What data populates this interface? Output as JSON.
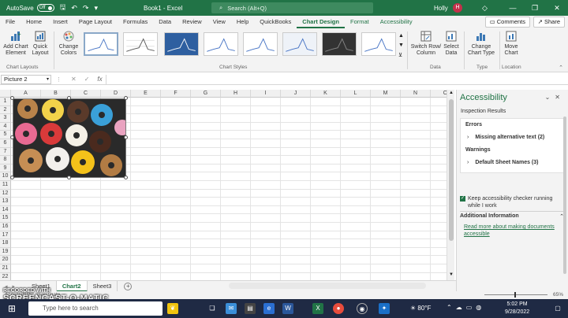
{
  "titlebar": {
    "autosave_label": "AutoSave",
    "autosave_state": "Off",
    "doc_title": "Book1 - Excel",
    "search_placeholder": "Search (Alt+Q)",
    "user_name": "Holly",
    "user_initial": "H"
  },
  "tabs": [
    "File",
    "Home",
    "Insert",
    "Page Layout",
    "Formulas",
    "Data",
    "Review",
    "View",
    "Help",
    "QuickBooks",
    "Chart Design",
    "Format",
    "Accessibility"
  ],
  "active_tab": "Chart Design",
  "actions": {
    "comments": "Comments",
    "share": "Share"
  },
  "ribbon": {
    "add_chart_element": "Add Chart Element",
    "quick_layout": "Quick Layout",
    "change_colors": "Change Colors",
    "chart_layouts_label": "Chart Layouts",
    "chart_styles_label": "Chart Styles",
    "switch_row_column": "Switch Row/ Column",
    "select_data": "Select Data",
    "data_label": "Data",
    "change_chart_type": "Change Chart Type",
    "type_label": "Type",
    "move_chart": "Move Chart",
    "location_label": "Location"
  },
  "formula_bar": {
    "name_box": "Picture 2",
    "fx": "fx",
    "formula": ""
  },
  "columns": [
    "A",
    "B",
    "C",
    "D",
    "E",
    "F",
    "G",
    "H",
    "I",
    "J",
    "K",
    "L",
    "M",
    "N",
    "O"
  ],
  "rows": [
    "1",
    "2",
    "3",
    "4",
    "5",
    "6",
    "7",
    "8",
    "9",
    "10",
    "11",
    "12",
    "13",
    "14",
    "15",
    "16",
    "17",
    "18",
    "19",
    "20",
    "21",
    "22"
  ],
  "sheets": [
    "Sheet1",
    "Chart2",
    "Sheet3"
  ],
  "active_sheet": "Chart2",
  "status": {
    "accessibility": "Accessibility: Investigate",
    "zoom": "65%"
  },
  "watermark": {
    "line1": "RECORDED WITH",
    "line2": "SCREENCAST-O-MATIC"
  },
  "pane": {
    "title": "Accessibility",
    "subtitle": "Inspection Results",
    "errors_label": "Errors",
    "error_item": "Missing alternative text (2)",
    "warnings_label": "Warnings",
    "warning_item": "Default Sheet Names (3)",
    "keep_running": "Keep accessibility checker running while I work",
    "additional_info": "Additional Information",
    "learn_more": "Read more about making documents accessible"
  },
  "taskbar": {
    "search_placeholder": "Type here to search",
    "weather": "80°F",
    "time": "5:02 PM",
    "date": "9/28/2022"
  },
  "colors": {
    "excel_green": "#217346",
    "taskbar": "#1f2a44"
  }
}
